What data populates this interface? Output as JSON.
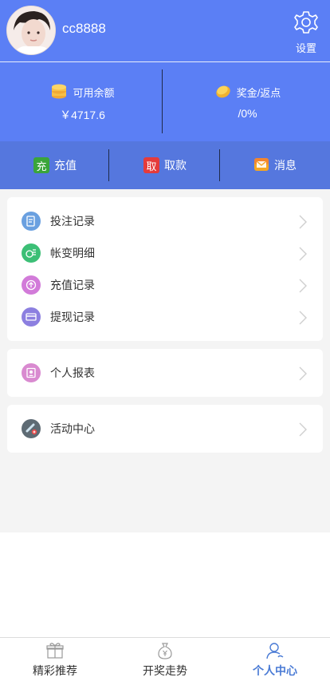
{
  "header": {
    "username": "cc8888",
    "settings_label": "设置"
  },
  "balance": {
    "available_label": "可用余额",
    "available_value": "￥4717.6",
    "bonus_label": "奖金/返点",
    "bonus_value": "/0%"
  },
  "actions": [
    {
      "badge": "充",
      "label": "充值",
      "color": "#3aa53a"
    },
    {
      "badge": "取",
      "label": "取款",
      "color": "#e53b3b"
    },
    {
      "badge": "",
      "label": "消息",
      "color": "#f5a623"
    }
  ],
  "menu_group_1": [
    {
      "label": "投注记录",
      "icon": "bet-record-icon",
      "color": "#6aa0e0"
    },
    {
      "label": "帐变明细",
      "icon": "account-change-icon",
      "color": "#3cbf76"
    },
    {
      "label": "充值记录",
      "icon": "recharge-record-icon",
      "color": "#d27bd9"
    },
    {
      "label": "提现记录",
      "icon": "withdraw-record-icon",
      "color": "#8c7fe0"
    }
  ],
  "menu_group_2": [
    {
      "label": "个人报表",
      "icon": "personal-report-icon",
      "color": "#d98ad0"
    }
  ],
  "menu_group_3": [
    {
      "label": "活动中心",
      "icon": "activity-center-icon",
      "color": "#5e6b74"
    }
  ],
  "tabbar": [
    {
      "label": "精彩推荐",
      "icon": "gift-icon"
    },
    {
      "label": "开奖走势",
      "icon": "money-bag-icon"
    },
    {
      "label": "个人中心",
      "icon": "user-icon",
      "active": true
    }
  ],
  "colors": {
    "header_bg": "#5b7ff5",
    "actions_bg": "#5577de",
    "active_tab": "#4a7bd5"
  }
}
